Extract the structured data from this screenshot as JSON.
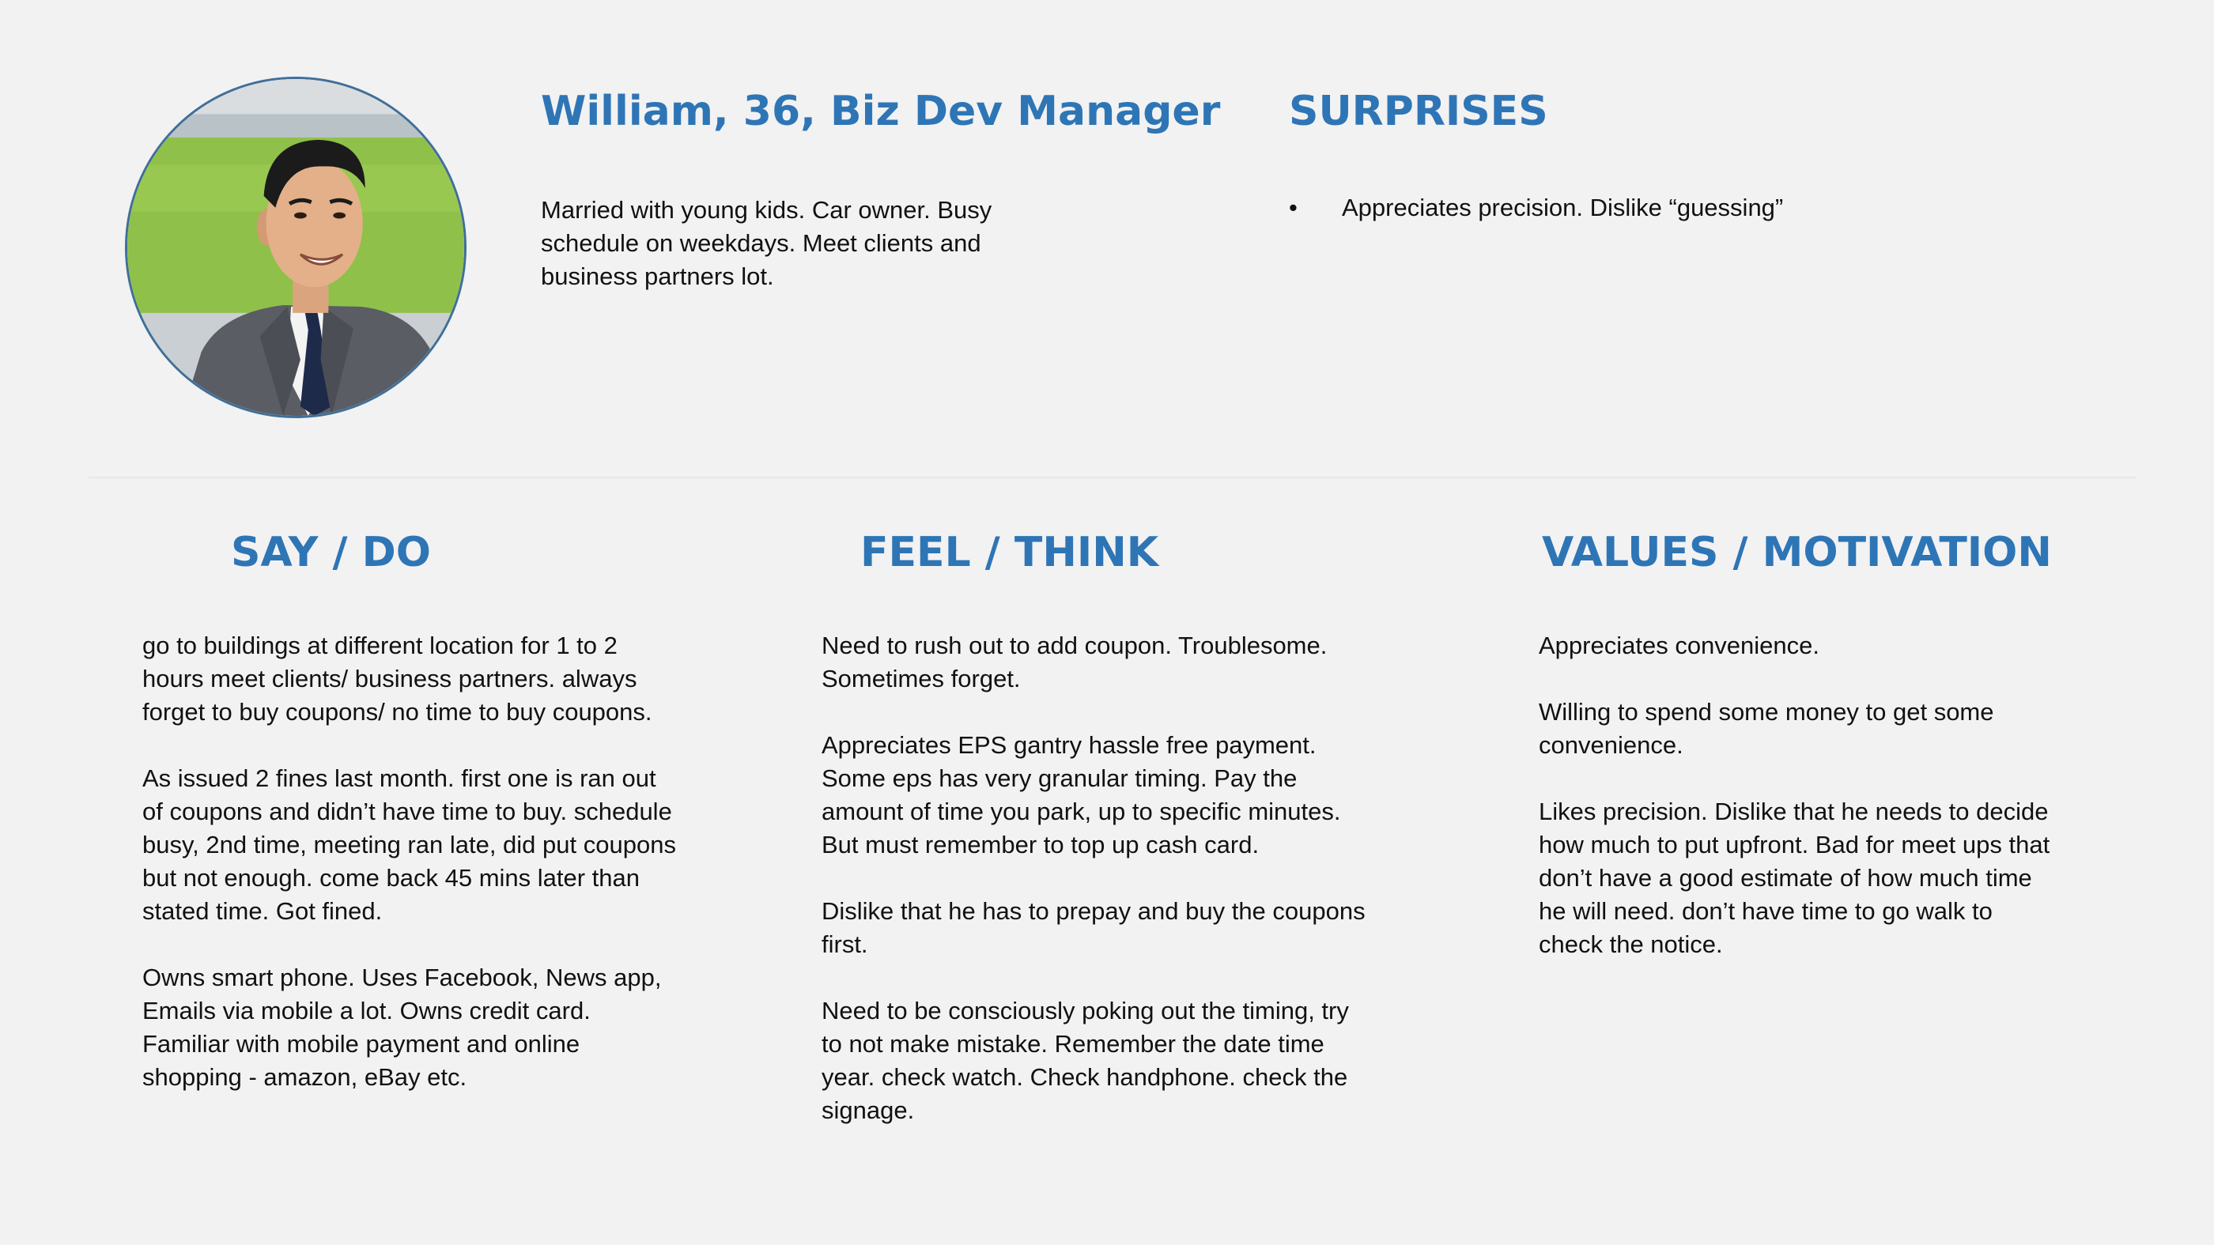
{
  "persona": {
    "title": "William, 36, Biz Dev Manager",
    "description": "Married with young kids. Car owner. Busy schedule on weekdays.  Meet clients and business partners  lot."
  },
  "surprises": {
    "heading": "SURPRISES",
    "bullet": "•",
    "items": [
      "Appreciates precision. Dislike “guessing”"
    ]
  },
  "say_do": {
    "heading": "SAY / DO",
    "paragraphs": [
      "go to buildings at different location for 1 to 2 hours meet clients/ business partners. always forget to buy coupons/ no time to buy coupons.",
      "As issued 2 fines last month. first one is ran out of coupons and didn’t have time to buy. schedule busy,  2nd time, meeting ran late, did put coupons but not enough. come back 45 mins later than stated time. Got fined.",
      "Owns smart phone. Uses Facebook, News app, Emails via mobile a lot. Owns credit card. Familiar with mobile payment and online shopping - amazon, eBay etc."
    ]
  },
  "feel_think": {
    "heading": "FEEL / THINK",
    "paragraphs": [
      "Need to rush out to add coupon. Troublesome. Sometimes forget.",
      "Appreciates EPS gantry hassle free payment. Some eps has very granular timing. Pay the amount of time you park, up to specific minutes. But must remember to top up cash card.",
      "Dislike that he has to prepay and buy the coupons first.",
      "Need to be consciously poking out the timing, try to not make mistake. Remember the date time year. check watch. Check handphone. check the signage."
    ]
  },
  "values_motivation": {
    "heading": "VALUES / MOTIVATION",
    "paragraphs": [
      "Appreciates convenience.",
      "Willing to spend some money to get some convenience.",
      "Likes precision. Dislike that he needs to decide how much to put upfront. Bad for meet ups that don’t have a good estimate of how much time he will need. don’t have time to go walk to check the notice."
    ]
  },
  "colors": {
    "heading": "#2e75b6",
    "background": "#f2f2f2",
    "text": "#111111"
  },
  "icons": {
    "avatar": "persona-photo"
  }
}
